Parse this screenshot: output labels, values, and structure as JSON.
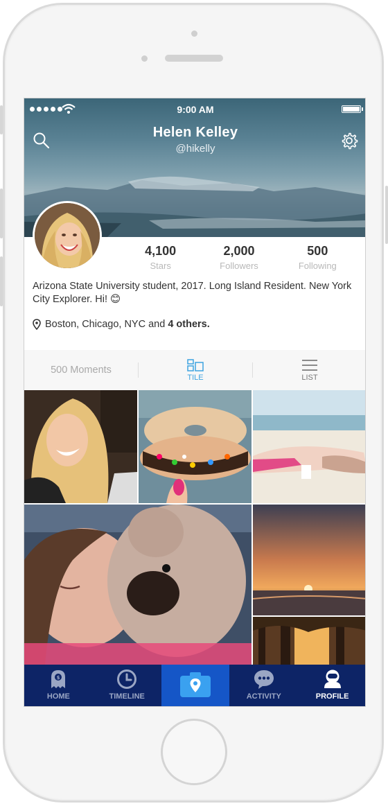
{
  "status": {
    "time": "9:00 AM"
  },
  "profile": {
    "name": "Helen Kelley",
    "handle": "@hikelly",
    "stats": [
      {
        "value": "4,100",
        "label": "Stars"
      },
      {
        "value": "2,000",
        "label": "Followers"
      },
      {
        "value": "500",
        "label": "Following"
      }
    ],
    "bio": "Arizona State University student, 2017. Long Island Resident. New York City Explorer. Hi! 😊",
    "location_prefix": "Boston, Chicago, NYC and ",
    "location_more": "4 others."
  },
  "tabs": {
    "moments": "500 Moments",
    "tile": "TILE",
    "list": "LIST"
  },
  "nav": {
    "home": "HOME",
    "timeline": "TIMELINE",
    "activity": "ACTIVITY",
    "profile": "PROFILE"
  },
  "colors": {
    "accent": "#3da3e0",
    "nav_bg": "#0d2466",
    "camera_bg": "#1556c7"
  }
}
